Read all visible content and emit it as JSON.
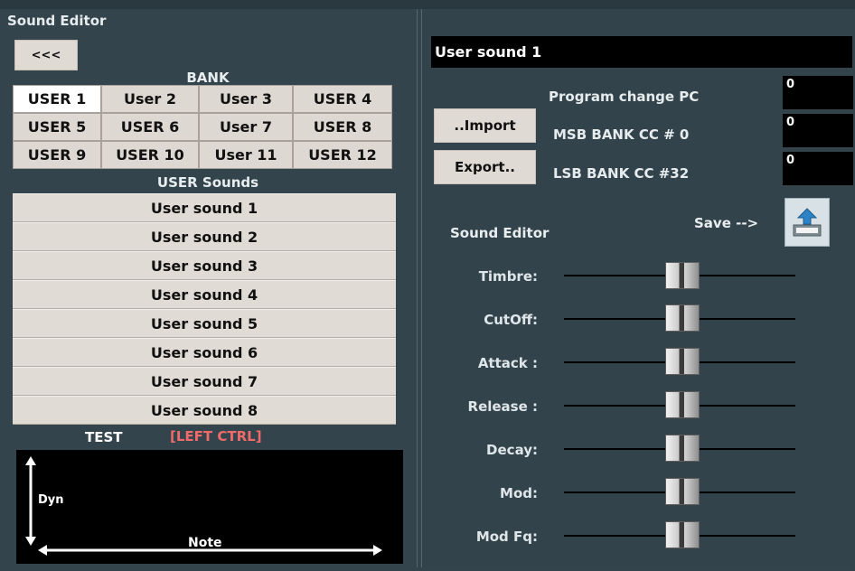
{
  "window": {
    "title": "Sound Editor"
  },
  "left_panel": {
    "back_label": "<<<",
    "bank_label": "BANK",
    "bank_cells": [
      "USER 1",
      "User 2",
      "User 3",
      "USER 4",
      "USER 5",
      "USER 6",
      "User 7",
      "USER 8",
      "USER 9",
      "USER 10",
      "User 11",
      "USER 12"
    ],
    "sounds_label": "USER Sounds",
    "sounds": [
      "User sound 1",
      "User sound 2",
      "User sound 3",
      "User sound 4",
      "User sound 5",
      "User sound 6",
      "User sound 7",
      "User sound 8"
    ],
    "test_label": "TEST",
    "ctrl_label": "[LEFT CTRL]",
    "dyn_label": "Dyn",
    "note_label": "Note"
  },
  "right_panel": {
    "sound_name": "User sound 1",
    "import_label": "..Import",
    "export_label": "Export..",
    "program_change_label": "Program change PC",
    "program_change_value": "0",
    "msb_label": "MSB BANK CC # 0",
    "msb_value": "0",
    "lsb_label": "LSB BANK CC  #32",
    "lsb_value": "0",
    "editor_title": "Sound Editor",
    "save_label": "Save -->",
    "params": [
      {
        "label": "Timbre:"
      },
      {
        "label": "CutOff:"
      },
      {
        "label": "Attack :"
      },
      {
        "label": "Release :"
      },
      {
        "label": "Decay:"
      },
      {
        "label": "Mod:"
      },
      {
        "label": "Mod Fq:"
      }
    ]
  },
  "colors": {
    "background": "#34444d",
    "button_bg": "#e0dad4",
    "field_bg": "#000000",
    "ctrl_label": "#f06a6a",
    "active_bank": "#ffffff"
  },
  "icons": [
    "save-icon",
    "up-arrow-icon",
    "down-arrow-icon",
    "left-arrow-icon",
    "right-arrow-icon"
  ]
}
